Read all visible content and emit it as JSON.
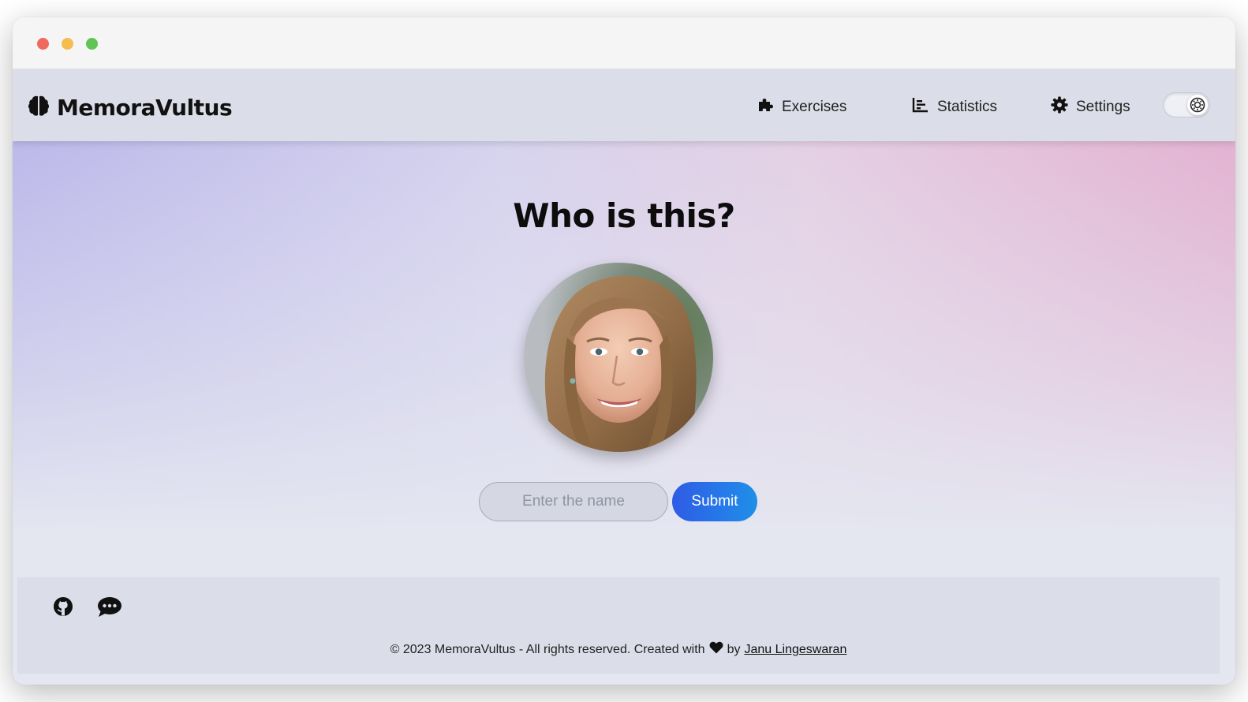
{
  "navbar": {
    "brand": "MemoraVultus",
    "items": [
      {
        "label": "Exercises",
        "icon": "puzzle-icon"
      },
      {
        "label": "Statistics",
        "icon": "bar-chart-icon"
      },
      {
        "label": "Settings",
        "icon": "gear-icon"
      }
    ],
    "theme_toggle_icon": "sun-icon"
  },
  "main": {
    "title": "Who is this?",
    "name_input": {
      "placeholder": "Enter the name",
      "value": ""
    },
    "submit_label": "Submit"
  },
  "footer": {
    "copyright_text": "© 2023 MemoraVultus - All rights reserved. Created with",
    "by_text": "by",
    "author": "Janu Lingeswaran"
  },
  "colors": {
    "accent_start": "#2f5be6",
    "accent_end": "#1f8fe9",
    "navbar_bg": "#dbdde8"
  }
}
